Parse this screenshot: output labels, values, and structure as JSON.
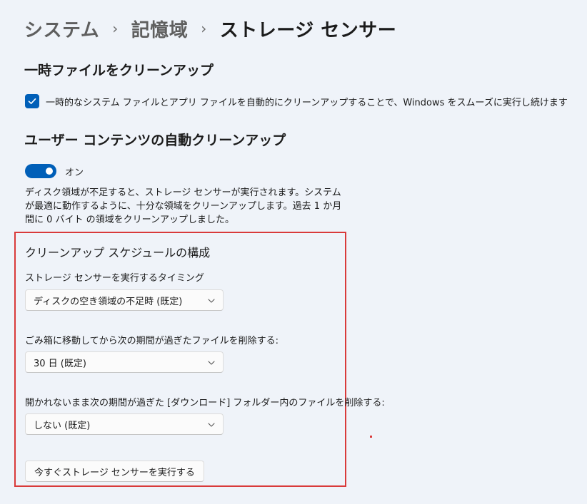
{
  "breadcrumb": {
    "items": [
      "システム",
      "記憶域",
      "ストレージ センサー"
    ],
    "separator": "›"
  },
  "temp_files": {
    "heading": "一時ファイルをクリーンアップ",
    "checkbox_checked": true,
    "checkbox_label": "一時的なシステム ファイルとアプリ ファイルを自動的にクリーンアップすることで、Windows をスムーズに実行し続けます"
  },
  "user_content": {
    "heading": "ユーザー コンテンツの自動クリーンアップ",
    "toggle_on": true,
    "toggle_label": "オン",
    "description": "ディスク領域が不足すると、ストレージ センサーが実行されます。システムが最適に動作するように、十分な領域をクリーンアップします。過去 1 か月間に 0 バイト の領域をクリーンアップしました。"
  },
  "schedule": {
    "title": "クリーンアップ スケジュールの構成",
    "run_timing_label": "ストレージ センサーを実行するタイミング",
    "run_timing_value": "ディスクの空き領域の不足時 (既定)",
    "recycle_bin_label": "ごみ箱に移動してから次の期間が過ぎたファイルを削除する:",
    "recycle_bin_value": "30 日 (既定)",
    "downloads_label": "開かれないまま次の期間が過ぎた [ダウンロード] フォルダー内のファイルを削除する:",
    "downloads_value": "しない (既定)",
    "run_now_button": "今すぐストレージ センサーを実行する"
  },
  "colors": {
    "accent": "#005fb8",
    "highlight_border": "#d93a3a",
    "background": "#eff3f9"
  }
}
